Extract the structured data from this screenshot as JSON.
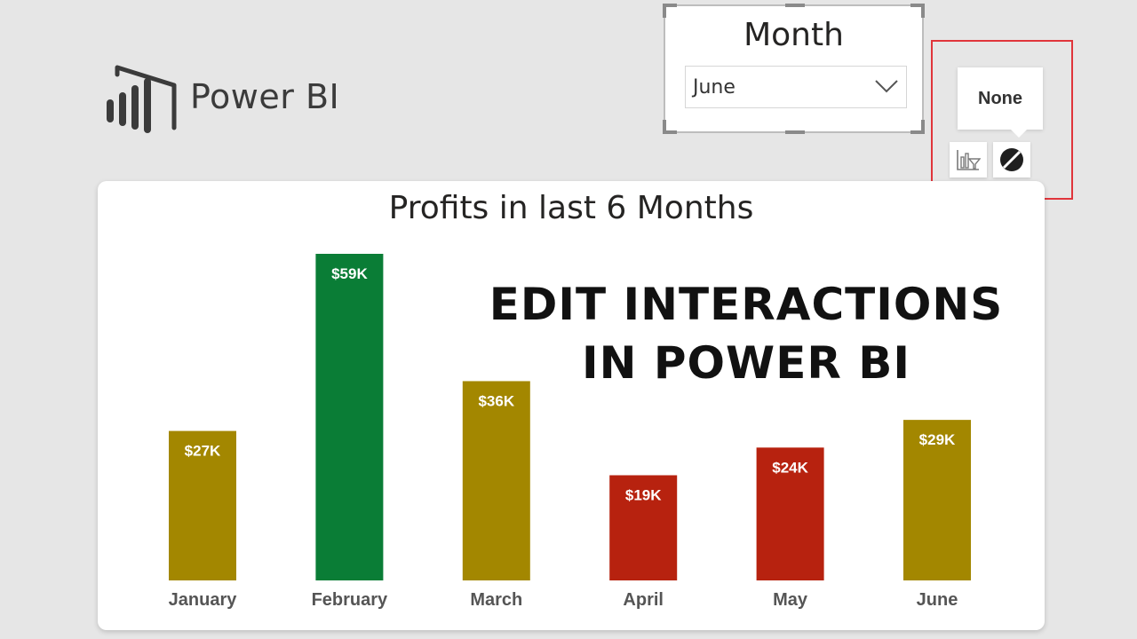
{
  "logo": {
    "text": "Power BI",
    "icon": "power-bi-logo"
  },
  "slicer": {
    "title": "Month",
    "selected": "June",
    "icon": "chevron-down-icon"
  },
  "interaction": {
    "tooltip": "None",
    "filter_icon": "filter-interaction-icon",
    "none_icon": "none-interaction-icon",
    "highlight_color": "#e0353b"
  },
  "headline": {
    "line1": "EDIT INTERACTIONS",
    "line2": "IN POWER BI"
  },
  "chart_data": {
    "type": "bar",
    "title": "Profits in last 6 Months",
    "categories": [
      "January",
      "February",
      "March",
      "April",
      "May",
      "June"
    ],
    "values": [
      27,
      59,
      36,
      19,
      24,
      29
    ],
    "labels": [
      "$27K",
      "$59K",
      "$36K",
      "$19K",
      "$24K",
      "$29K"
    ],
    "unit": "K",
    "colors": [
      "#a38700",
      "#0a7d36",
      "#a38700",
      "#b7220f",
      "#b7220f",
      "#a38700"
    ],
    "ylim": [
      0,
      59
    ],
    "grid": false,
    "xlabel": "",
    "ylabel": ""
  }
}
